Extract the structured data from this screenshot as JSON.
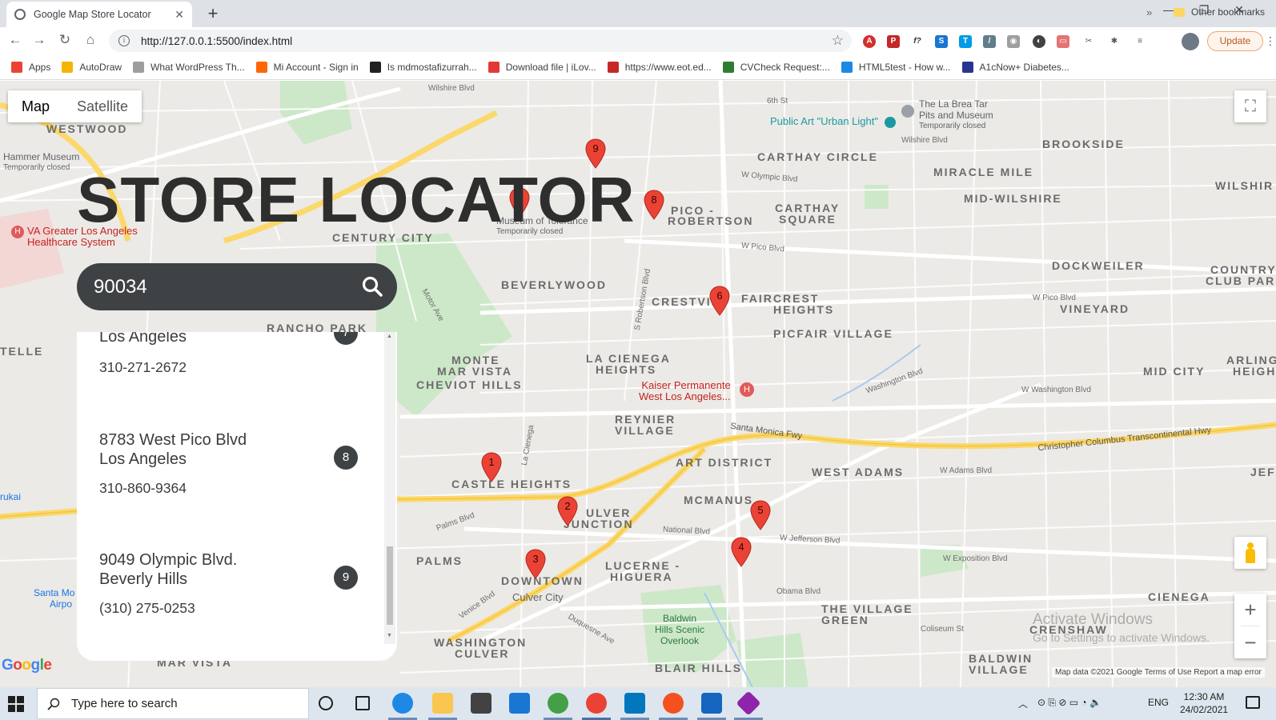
{
  "browser": {
    "tab_title": "Google Map Store Locator",
    "url": "http://127.0.0.1:5500/index.html",
    "update_label": "Update",
    "bookmarks": [
      {
        "label": "Apps",
        "color": "#ea4335"
      },
      {
        "label": "AutoDraw",
        "color": "#f4b400"
      },
      {
        "label": "What WordPress Th...",
        "color": "#9e9e9e"
      },
      {
        "label": "Mi Account - Sign in",
        "color": "#ff6700"
      },
      {
        "label": "Is mdmostafizurrah...",
        "color": "#222222"
      },
      {
        "label": "Download file | iLov...",
        "color": "#e53935"
      },
      {
        "label": "https://www.eot.ed...",
        "color": "#c62828"
      },
      {
        "label": "CVCheck Request:...",
        "color": "#2e7d32"
      },
      {
        "label": "HTML5test - How w...",
        "color": "#1e88e5"
      },
      {
        "label": "A1cNow+ Diabetes...",
        "color": "#283593"
      }
    ],
    "bookmarks_more": "»",
    "other_bookmarks": "Other bookmarks"
  },
  "map": {
    "type_map": "Map",
    "type_satellite": "Satellite",
    "google_logo": "Google",
    "attribution": "Map data ©2021 Google   Terms of Use   Report a map error",
    "activate_line1": "Activate Windows",
    "activate_line2": "Go to Settings to activate Windows.",
    "neighborhoods": [
      "WESTWOOD",
      "CENTURY CITY",
      "RANCHO PARK",
      "BEVERLYWOOD",
      "CARTHAY CIRCLE",
      "CARTHAY",
      "SQUARE",
      "MIRACLE MILE",
      "MID-WILSHIRE",
      "BROOKSIDE",
      "WILSHIR",
      "DOCKWEILER",
      "COUNTRY",
      "CLUB PAR",
      "VINEYARD",
      "PICFAIR VILLAGE",
      "CRESTVIE",
      "FAIRCREST",
      "HEIGHTS",
      "PICO -",
      "ROBERTSON",
      "MONTE",
      "MAR VISTA",
      "CHEVIOT HILLS",
      "LA CIENEGA",
      "HEIGHTS",
      "REYNIER",
      "VILLAGE",
      "ART DISTRICT",
      "WEST ADAMS",
      "MID CITY",
      "ARLING",
      "HEIGH",
      "CASTLE HEIGHTS",
      "MCMANUS",
      "ULVER",
      "JUNCTION",
      "PALMS",
      "DOWNTOWN",
      "LUCERNE -",
      "HIGUERA",
      "THE VILLAGE",
      "GREEN",
      "CIENEGA",
      "CRENSHAW",
      "WASHINGTON",
      "CULVER",
      "BLAIR HILLS",
      "BALDWIN",
      "VILLAGE",
      "MAR VISTA",
      "TELLE",
      "JEF"
    ],
    "streets": [
      "Wilshire Blvd",
      "6th St",
      "W Olympic Blvd",
      "Wilshire Blvd",
      "W Pico Blvd",
      "W Pico Blvd",
      "Santa Monica Fwy",
      "Christopher Columbus Transcontinental Hwy",
      "National Blvd",
      "W Jefferson Blvd",
      "W Exposition Blvd",
      "Venice Blvd",
      "Palms Blvd",
      "Obama Blvd",
      "Coliseum St",
      "Washington Blvd",
      "W Washington Blvd",
      "W Adams Blvd",
      "Duquesne Ave",
      "Motor Ave",
      "S Robertson Blvd",
      "La Cienega"
    ],
    "pois": {
      "hammer_museum": "Hammer Museum",
      "hammer_closed": "Temporarily closed",
      "va_line1": "VA Greater Los Angeles",
      "va_line2": "Healthcare System",
      "museum": "Museum of Tolerance",
      "museum_closed": "Temporarily closed",
      "labrea_line1": "The La Brea Tar",
      "labrea_line2": "Pits and Museum",
      "labrea_closed": "Temporarily closed",
      "public_art": "Public Art \"Urban Light\"",
      "kaiser_line1": "Kaiser Permanente",
      "kaiser_line2": "West Los Angeles...",
      "baldwin_line1": "Baldwin",
      "baldwin_line2": "Hills Scenic",
      "baldwin_line3": "Overlook",
      "santa_monica_line1": "Santa Mo",
      "santa_monica_line2": "Airpo",
      "culver_city": "Culver City",
      "rukai": "rukai"
    },
    "markers": [
      "1",
      "2",
      "3",
      "4",
      "5",
      "6",
      "7",
      "8",
      "9"
    ]
  },
  "locator": {
    "title": "STORE LOCATOR",
    "search_value": "90034",
    "stores": [
      {
        "line1": "",
        "line2": "Los Angeles",
        "phone": "310-271-2672",
        "num": "7"
      },
      {
        "line1": "8783 West Pico Blvd",
        "line2": "Los Angeles",
        "phone": "310-860-9364",
        "num": "8"
      },
      {
        "line1": "9049 Olympic Blvd.",
        "line2": "Beverly Hills",
        "phone": "(310) 275-0253",
        "num": "9"
      }
    ]
  },
  "taskbar": {
    "search_placeholder": "Type here to search",
    "lang": "ENG",
    "time": "12:30 AM",
    "date": "24/02/2021",
    "notif_count": "1"
  }
}
